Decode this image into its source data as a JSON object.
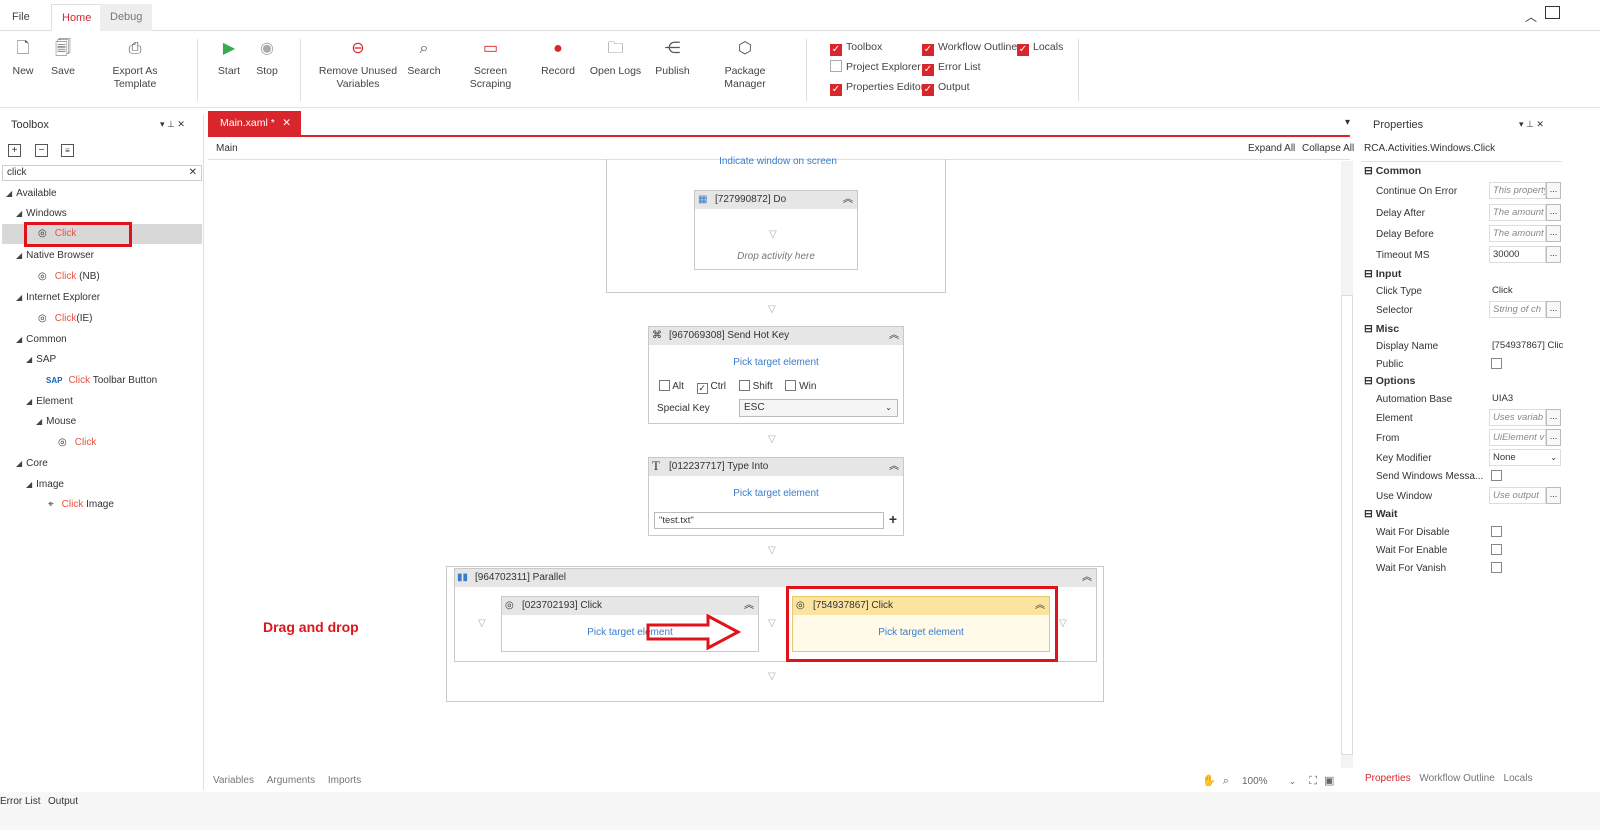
{
  "menu": {
    "file": "File",
    "home": "Home",
    "debug": "Debug"
  },
  "ribbon": {
    "new": "New",
    "save": "Save",
    "export": "Export As Template",
    "start": "Start",
    "stop": "Stop",
    "remove_unused": "Remove Unused\nVariables",
    "search": "Search",
    "screen_scraping": "Screen Scraping",
    "record": "Record",
    "open_logs": "Open Logs",
    "publish": "Publish",
    "package_manager": "Package Manager",
    "checks": {
      "toolbox": "Toolbox",
      "workflow_outline": "Workflow Outline",
      "locals": "Locals",
      "project_explorer": "Project Explorer",
      "error_list": "Error List",
      "properties_editor": "Properties Editor",
      "output": "Output"
    }
  },
  "toolbox": {
    "title": "Toolbox",
    "search_value": "click",
    "tree": {
      "available": "Available",
      "windows": "Windows",
      "windows_click": "Click",
      "native_browser": "Native Browser",
      "nb_click_hl": "Click",
      "nb_click_rest": " (NB)",
      "internet_explorer": "Internet Explorer",
      "ie_click_hl": "Click",
      "ie_click_rest": "(IE)",
      "common": "Common",
      "sap": "SAP",
      "sap_hl": "Click",
      "sap_rest": " Toolbar Button",
      "element": "Element",
      "mouse": "Mouse",
      "mouse_click": "Click",
      "core": "Core",
      "image": "Image",
      "image_hl": "Click",
      "image_rest": " Image"
    }
  },
  "doc": {
    "tab": "Main.xaml *",
    "breadcrumb": "Main",
    "expand_all": "Expand All",
    "collapse_all": "Collapse All",
    "indicate_window": "Indicate window on screen",
    "do_title": "[727990872] Do",
    "drop_here": "Drop activity here",
    "hotkey_title": "[967069308] Send Hot Key",
    "pick_target": "Pick target element",
    "alt": "Alt",
    "ctrl": "Ctrl",
    "shift": "Shift",
    "win": "Win",
    "special_key_label": "Special Key",
    "special_key_value": "ESC",
    "type_title": "[012237717] Type Into",
    "type_value": "\"test.txt\"",
    "parallel_title": "[964702311] Parallel",
    "click1_title": "[023702193] Click",
    "click2_title": "[754937867] Click",
    "drag_drop": "Drag and drop",
    "bottom_tabs": [
      "Variables",
      "Arguments",
      "Imports"
    ],
    "zoom": "100%"
  },
  "props": {
    "title": "Properties",
    "type": "RCA.Activities.Windows.Click",
    "sections": {
      "common": "Common",
      "input": "Input",
      "misc": "Misc",
      "options": "Options",
      "wait": "Wait"
    },
    "rows": {
      "continue_on_error": "Continue On Error",
      "continue_on_error_v": "This property",
      "delay_after": "Delay After",
      "delay_after_v": "The amount",
      "delay_before": "Delay Before",
      "delay_before_v": "The amount",
      "timeout": "Timeout MS",
      "timeout_v": "30000",
      "click_type": "Click Type",
      "click_type_v": "Click",
      "selector": "Selector",
      "selector_v": "String of ch",
      "display_name": "Display Name",
      "display_name_v": "[754937867] Clic",
      "public": "Public",
      "automation_base": "Automation Base",
      "automation_base_v": "UIA3",
      "element": "Element",
      "element_v": "Uses variab",
      "from": "From",
      "from_v": "UiElement v",
      "key_modifier": "Key Modifier",
      "key_modifier_v": "None",
      "send_windows": "Send Windows Messa...",
      "use_window": "Use Window",
      "use_window_v": "Use output",
      "wait_disable": "Wait For Disable",
      "wait_enable": "Wait For Enable",
      "wait_vanish": "Wait For Vanish"
    },
    "bottom_tabs": [
      "Properties",
      "Workflow Outline",
      "Locals"
    ]
  },
  "footer": {
    "error_list": "Error List",
    "output": "Output"
  },
  "colors": {
    "accent": "#d9262c",
    "link": "#3a7cc9",
    "highlight_bg": "#fdf0b4"
  }
}
